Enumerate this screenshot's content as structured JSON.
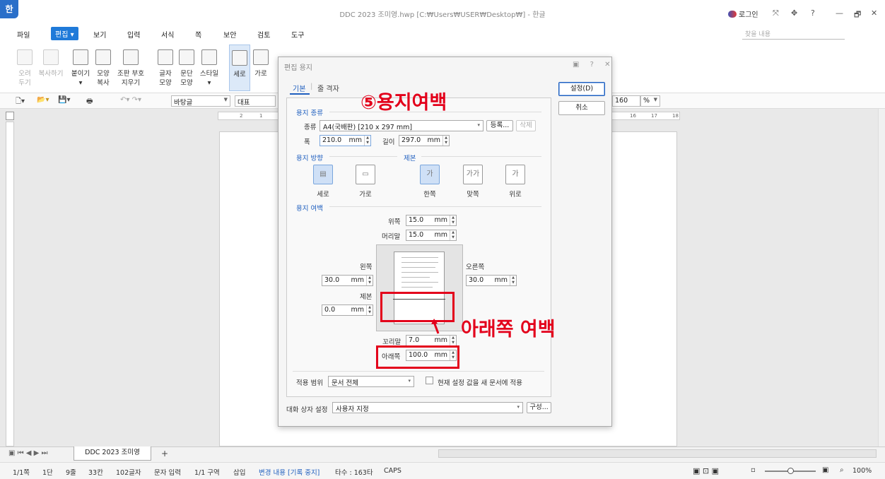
{
  "app": {
    "logo": "한",
    "window_title": "DDC 2023 조미영.hwp [C:₩Users₩USER₩Desktop₩] - 한글",
    "login": "로그인",
    "title_controls": [
      "⤧",
      "✥",
      "?",
      "—",
      "🗗",
      "✕"
    ]
  },
  "menubar": {
    "items": [
      "파일",
      "편집",
      "보기",
      "입력",
      "서식",
      "쪽",
      "보안",
      "검토",
      "도구"
    ],
    "active": "편집",
    "search_placeholder": "찾을 내용"
  },
  "ribbon": {
    "items": [
      {
        "label1": "오려",
        "label2": "두기",
        "dim": true
      },
      {
        "label1": "복사하기",
        "label2": "",
        "dim": true
      },
      {
        "label1": "붙이기",
        "label2": "▾",
        "dim": false
      },
      {
        "label1": "모양",
        "label2": "복사",
        "dim": false
      },
      {
        "label1": "조판 부호",
        "label2": "지우기",
        "dim": false
      },
      {
        "label1": "글자",
        "label2": "모양",
        "dim": false
      },
      {
        "label1": "문단",
        "label2": "모양",
        "dim": false
      },
      {
        "label1": "스타일",
        "label2": "▾",
        "dim": false
      },
      {
        "label1": "세로",
        "label2": "",
        "dim": false
      },
      {
        "label1": "가로",
        "label2": "",
        "dim": false
      }
    ]
  },
  "format_toolbar": {
    "style": "바탕글",
    "style_preset": "대표",
    "zoom": "160",
    "zoom_unit": "%"
  },
  "ruler": {
    "h_ticks": [
      "2",
      "1",
      "16",
      "17",
      "18"
    ]
  },
  "dialog": {
    "title": "편집 용지",
    "title_controls": "▣ ? ✕",
    "tabs": [
      "기본",
      "줄 격자"
    ],
    "active_tab": "기본",
    "ok": "설정(D)",
    "cancel": "취소",
    "paper_kind": {
      "section": "용지 종류",
      "kind_label": "종류",
      "kind_value": "A4(국배판) [210 x 297 mm]",
      "register": "등록...",
      "delete": "삭제",
      "width_label": "폭",
      "width_value": "210.0",
      "height_label": "길이",
      "height_value": "297.0",
      "unit": "mm"
    },
    "orientation": {
      "section": "용지 방향",
      "portrait": "세로",
      "landscape": "가로"
    },
    "binding": {
      "section": "제본",
      "single": "한쪽",
      "facing": "맞쪽",
      "top": "위로"
    },
    "margins": {
      "section": "용지 여백",
      "top_label": "위쪽",
      "top_value": "15.0",
      "header_label": "머리말",
      "header_value": "15.0",
      "left_label": "왼쪽",
      "left_value": "30.0",
      "right_label": "오른쪽",
      "right_value": "30.0",
      "gutter_label": "제본",
      "gutter_value": "0.0",
      "footer_label": "꼬리말",
      "footer_value": "7.0",
      "bottom_label": "아래쪽",
      "bottom_value": "100.0",
      "unit": "mm"
    },
    "apply_scope_label": "적용 범위",
    "apply_scope_value": "문서 전체",
    "apply_new_doc": "현재 설정 값을 새 문서에 적용",
    "dialog_setting_label": "대화 상자 설정",
    "dialog_setting_value": "사용자 지정",
    "configure": "구성..."
  },
  "annotations": {
    "step_title": "⑤용지여백",
    "bottom_margin_note": "아래쪽 여백",
    "color": "#e3001b"
  },
  "document_tab": {
    "name": "DDC 2023 조미영",
    "add": "+"
  },
  "statusbar": {
    "page": "1/1쪽",
    "column": "1단",
    "line": "9줄",
    "char": "33칸",
    "count": "102글자",
    "mode": "문자 입력",
    "section": "1/1 구역",
    "insert": "삽입",
    "track": "변경 내용 [기록 중지]",
    "keystrokes": "타수 : 163타",
    "caps": "CAPS",
    "zoom": "100%"
  }
}
